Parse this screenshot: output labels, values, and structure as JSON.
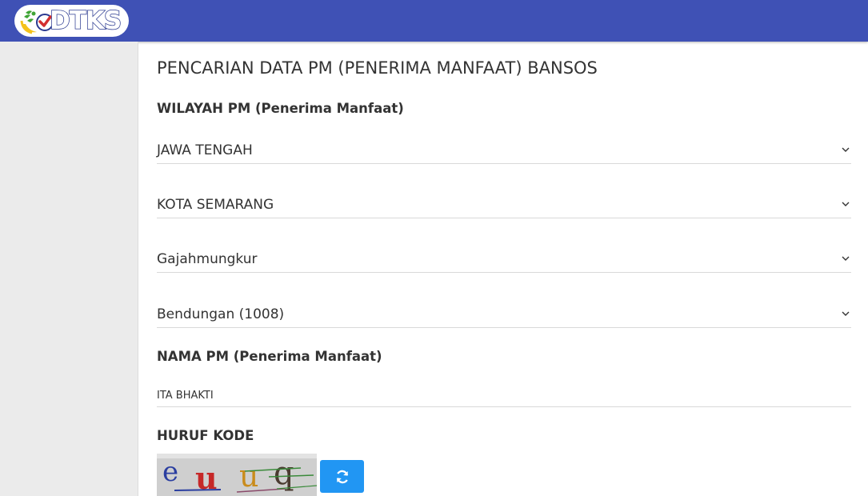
{
  "header": {
    "logo_text": "DTKS",
    "brand_color": "#3f51b5"
  },
  "form": {
    "title": "PENCARIAN DATA PM (PENERIMA MANFAAT) BANSOS",
    "wilayah_label": "WILAYAH PM (Penerima Manfaat)",
    "province": "JAWA TENGAH",
    "city": "KOTA SEMARANG",
    "district": "Gajahmungkur",
    "village": "Bendungan (1008)",
    "nama_label": "NAMA PM (Penerima Manfaat)",
    "nama_value": "ITA BHAKTI",
    "kode_label": "HURUF KODE",
    "captcha_text": "euuq",
    "refresh_icon": "refresh-icon",
    "refresh_color": "#2196f3"
  }
}
